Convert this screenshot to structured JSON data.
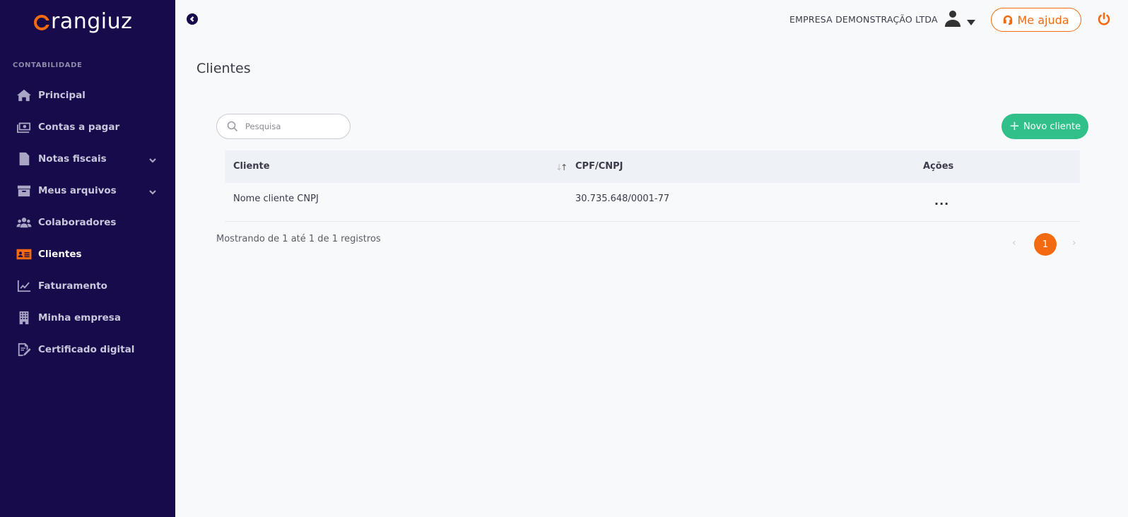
{
  "brand": {
    "logo_text": "rangiuz",
    "accent": "#f36a10",
    "sidebar_bg": "#170b4b",
    "success": "#31c08a"
  },
  "sidebar": {
    "section_label": "CONTABILIDADE",
    "items": [
      {
        "label": "Principal",
        "icon": "home-icon"
      },
      {
        "label": "Contas a pagar",
        "icon": "money-icon"
      },
      {
        "label": "Notas fiscais",
        "icon": "invoice-icon",
        "expandable": true
      },
      {
        "label": "Meus arquivos",
        "icon": "archive-icon",
        "expandable": true
      },
      {
        "label": "Colaboradores",
        "icon": "users-icon"
      },
      {
        "label": "Clientes",
        "icon": "id-card-icon",
        "active": true
      },
      {
        "label": "Faturamento",
        "icon": "chart-icon"
      },
      {
        "label": "Minha empresa",
        "icon": "building-icon"
      },
      {
        "label": "Certificado digital",
        "icon": "certificate-icon"
      }
    ]
  },
  "topbar": {
    "company_name": "EMPRESA DEMONSTRAÇÃO LTDA",
    "help_label": "Me ajuda"
  },
  "main": {
    "title": "Clientes",
    "search_placeholder": "Pesquisa",
    "new_button_label": "Novo cliente",
    "table": {
      "columns": [
        "Cliente",
        "CPF/CNPJ",
        "Ações"
      ],
      "rows": [
        {
          "cliente": "Nome cliente CNPJ",
          "documento": "30.735.648/0001-77",
          "acoes": "..."
        }
      ]
    },
    "records_text": "Mostrando de 1 até 1 de 1 registros",
    "pagination": {
      "prev": "‹",
      "current": "1",
      "next": "›"
    }
  }
}
